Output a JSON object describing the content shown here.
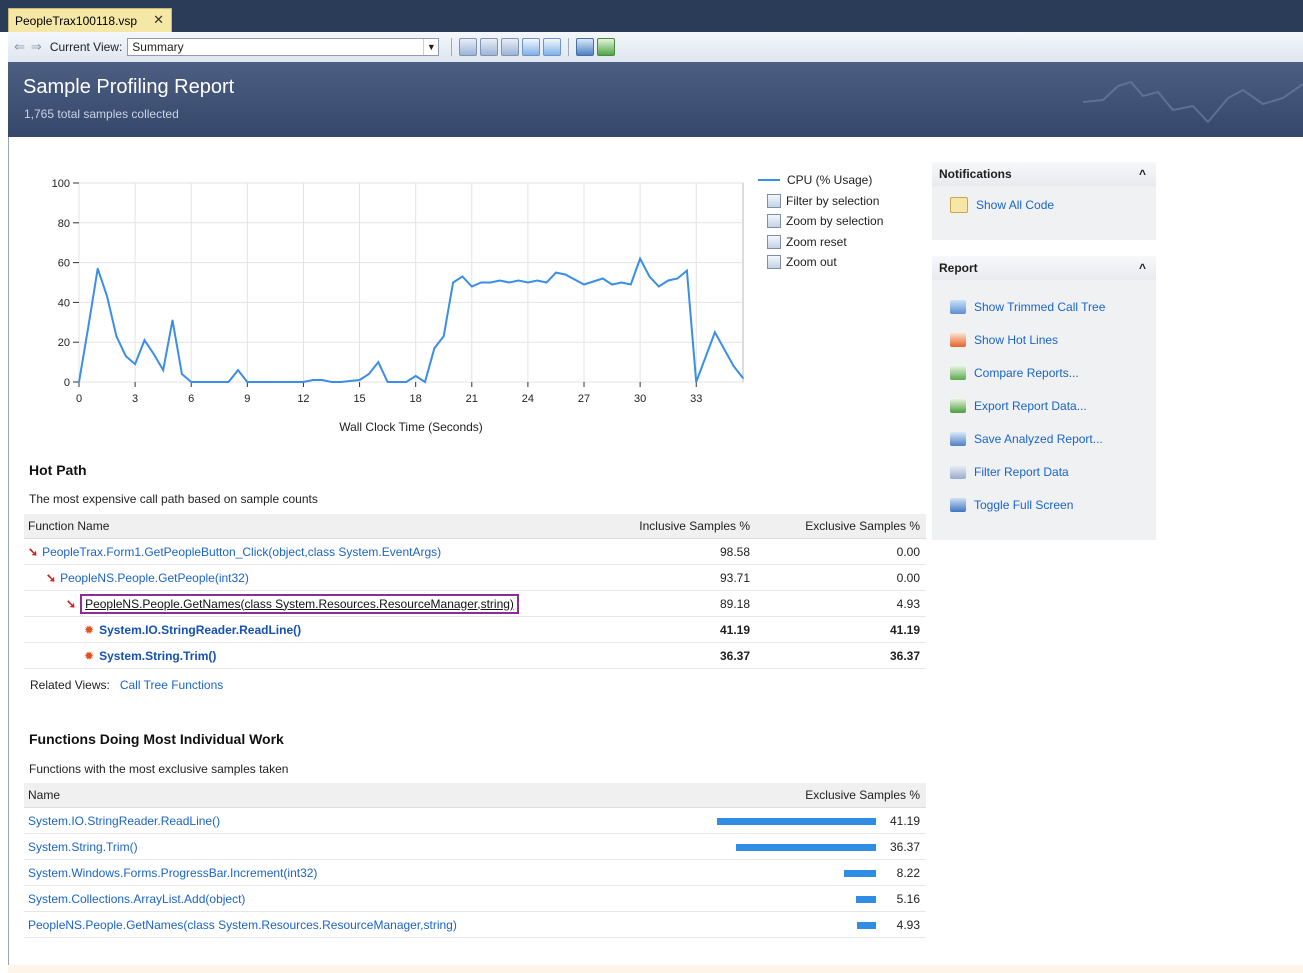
{
  "tab": {
    "title": "PeopleTrax100118.vsp",
    "close": "✕"
  },
  "toolbar": {
    "back": "⇐",
    "forward": "⇒",
    "current_view_label": "Current View:",
    "current_view_value": "Summary"
  },
  "header": {
    "title": "Sample Profiling Report",
    "subtitle": "1,765 total samples collected"
  },
  "chart_data": {
    "type": "line",
    "xlabel": "Wall Clock Time (Seconds)",
    "ylabel": "",
    "xlim": [
      0,
      35.5
    ],
    "ylim": [
      0,
      100
    ],
    "x_ticks": [
      0,
      3,
      6,
      9,
      12,
      15,
      18,
      21,
      24,
      27,
      30,
      33
    ],
    "y_ticks": [
      0,
      20,
      40,
      60,
      80,
      100
    ],
    "grid": true,
    "series": [
      {
        "name": "CPU (% Usage)",
        "color": "#3a8ee6",
        "points": [
          [
            0,
            0
          ],
          [
            0.5,
            28
          ],
          [
            1,
            57
          ],
          [
            1.5,
            43
          ],
          [
            2,
            23
          ],
          [
            2.5,
            13
          ],
          [
            3,
            9
          ],
          [
            3.5,
            21
          ],
          [
            4,
            14
          ],
          [
            4.5,
            6
          ],
          [
            5,
            31
          ],
          [
            5.5,
            4
          ],
          [
            6,
            0
          ],
          [
            7,
            0
          ],
          [
            8,
            0
          ],
          [
            8.5,
            6
          ],
          [
            9,
            0
          ],
          [
            10,
            0
          ],
          [
            11,
            0
          ],
          [
            12,
            0
          ],
          [
            12.5,
            1
          ],
          [
            13,
            1
          ],
          [
            13.5,
            0
          ],
          [
            14,
            0
          ],
          [
            15,
            1
          ],
          [
            15.5,
            4
          ],
          [
            16,
            10
          ],
          [
            16.5,
            0
          ],
          [
            17,
            0
          ],
          [
            17.5,
            0
          ],
          [
            18,
            3
          ],
          [
            18.5,
            0
          ],
          [
            19,
            17
          ],
          [
            19.5,
            23
          ],
          [
            20,
            50
          ],
          [
            20.5,
            53
          ],
          [
            21,
            48
          ],
          [
            21.5,
            50
          ],
          [
            22,
            50
          ],
          [
            22.5,
            51
          ],
          [
            23,
            50
          ],
          [
            23.5,
            51
          ],
          [
            24,
            50
          ],
          [
            24.5,
            51
          ],
          [
            25,
            50
          ],
          [
            25.5,
            55
          ],
          [
            26,
            54
          ],
          [
            27,
            49
          ],
          [
            28,
            52
          ],
          [
            28.5,
            49
          ],
          [
            29,
            50
          ],
          [
            29.5,
            49
          ],
          [
            30,
            62
          ],
          [
            30.5,
            53
          ],
          [
            31,
            48
          ],
          [
            31.5,
            51
          ],
          [
            32,
            52
          ],
          [
            32.5,
            56
          ],
          [
            33,
            0
          ],
          [
            34,
            25
          ],
          [
            35,
            8
          ],
          [
            35.5,
            2
          ]
        ]
      }
    ],
    "legend": "right",
    "legend_actions": [
      "Filter by selection",
      "Zoom by selection",
      "Zoom reset",
      "Zoom out"
    ]
  },
  "hot_path": {
    "title": "Hot Path",
    "description": "The most expensive call path based on sample counts",
    "columns": [
      "Function Name",
      "Inclusive Samples %",
      "Exclusive Samples %"
    ],
    "rows": [
      {
        "name": "PeopleTrax.Form1.GetPeopleButton_Click(object,class System.EventArgs)",
        "inclusive": "98.58",
        "exclusive": "0.00"
      },
      {
        "name": "PeopleNS.People.GetPeople(int32)",
        "inclusive": "93.71",
        "exclusive": "0.00"
      },
      {
        "name": "PeopleNS.People.GetNames(class System.Resources.ResourceManager,string)",
        "inclusive": "89.18",
        "exclusive": "4.93"
      },
      {
        "name": "System.IO.StringReader.ReadLine()",
        "inclusive": "41.19",
        "exclusive": "41.19"
      },
      {
        "name": "System.String.Trim()",
        "inclusive": "36.37",
        "exclusive": "36.37"
      }
    ],
    "related_label": "Related Views:",
    "related_links": [
      "Call Tree",
      "Functions"
    ]
  },
  "individual_work": {
    "title": "Functions Doing Most Individual Work",
    "description": "Functions with the most exclusive samples taken",
    "columns": [
      "Name",
      "Exclusive Samples %"
    ],
    "rows": [
      {
        "name": "System.IO.StringReader.ReadLine()",
        "value": "41.19",
        "fraction": 0.4119
      },
      {
        "name": "System.String.Trim()",
        "value": "36.37",
        "fraction": 0.3637
      },
      {
        "name": "System.Windows.Forms.ProgressBar.Increment(int32)",
        "value": "8.22",
        "fraction": 0.0822
      },
      {
        "name": "System.Collections.ArrayList.Add(object)",
        "value": "5.16",
        "fraction": 0.0516
      },
      {
        "name": "PeopleNS.People.GetNames(class System.Resources.ResourceManager,string)",
        "value": "4.93",
        "fraction": 0.0493
      }
    ]
  },
  "notifications": {
    "title": "Notifications",
    "collapse": "^",
    "items": [
      "Show All Code"
    ]
  },
  "report": {
    "title": "Report",
    "collapse": "^",
    "items": [
      "Show Trimmed Call Tree",
      "Show Hot Lines",
      "Compare Reports...",
      "Export Report Data...",
      "Save Analyzed Report...",
      "Filter Report Data",
      "Toggle Full Screen"
    ]
  },
  "colors": {
    "accent": "#3a8ee6",
    "link": "#1a64c8",
    "header": "#3d5075",
    "selection": "#8e2c97"
  }
}
